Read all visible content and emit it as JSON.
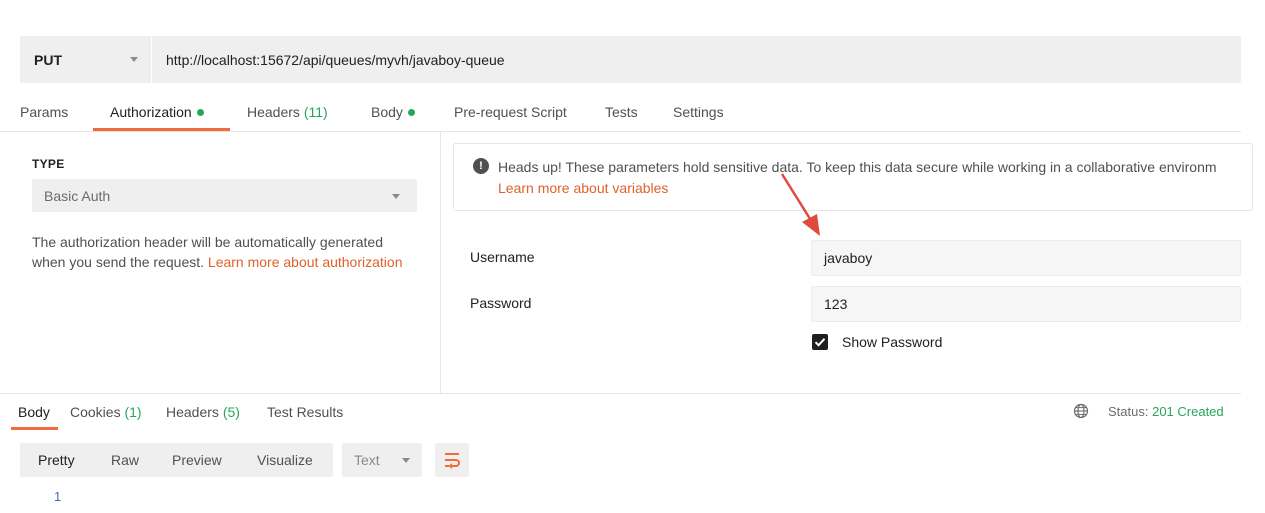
{
  "request": {
    "method": "PUT",
    "url": "http://localhost:15672/api/queues/myvh/javaboy-queue"
  },
  "req_tabs": {
    "params": "Params",
    "authorization": "Authorization",
    "headers": "Headers",
    "headers_count": "(11)",
    "body": "Body",
    "prerequest": "Pre-request Script",
    "tests": "Tests",
    "settings": "Settings"
  },
  "auth": {
    "type_label": "TYPE",
    "type_value": "Basic Auth",
    "desc_text": "The authorization header will be automatically generated when you send the request.",
    "desc_link": "Learn more about authorization"
  },
  "notice": {
    "message": "Heads up! These parameters hold sensitive data. To keep this data secure while working in a collaborative environm",
    "link": "Learn more about variables"
  },
  "fields": {
    "username_label": "Username",
    "username_value": "javaboy",
    "password_label": "Password",
    "password_value": "123",
    "show_password": "Show Password",
    "show_password_checked": true
  },
  "response": {
    "tabs": {
      "body": "Body",
      "cookies": "Cookies",
      "cookies_count": "(1)",
      "headers": "Headers",
      "headers_count": "(5)",
      "test_results": "Test Results"
    },
    "status_label": "Status:",
    "status_value": "201 Created",
    "formats": [
      "Pretty",
      "Raw",
      "Preview",
      "Visualize"
    ],
    "text_type": "Text",
    "line_number": "1"
  },
  "colors": {
    "accent": "#f26b3a",
    "link": "#e0622b",
    "success": "#26a65b",
    "annotation_arrow": "#e04a3a"
  },
  "icons": [
    "caret-down-icon",
    "info-icon",
    "checkbox-checked-icon",
    "globe-icon",
    "wrap-lines-icon",
    "annotation-arrow"
  ]
}
